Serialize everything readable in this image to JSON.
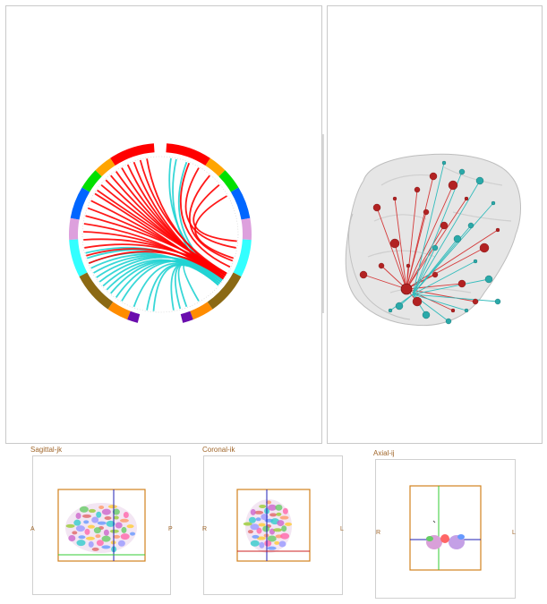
{
  "chord": {
    "ring_colors": [
      "#ff0000",
      "#ffa500",
      "#00e000",
      "#0066ff",
      "#dda0dd",
      "#33ffff",
      "#8b6914",
      "#ff8c00",
      "#6a0dad"
    ],
    "inter_color": "#ff0000",
    "intra_color": "#22d3d3"
  },
  "brain": {
    "node_colors": [
      "#b22222",
      "#2aa9a9"
    ]
  },
  "slices": {
    "sagittal": {
      "title": "Sagittal-jk",
      "left": "A",
      "right": "P"
    },
    "coronal": {
      "title": "Coronal-ik",
      "left": "R",
      "right": "L"
    },
    "axial": {
      "title": "Axial-ij",
      "left": "R",
      "right": "L"
    }
  }
}
